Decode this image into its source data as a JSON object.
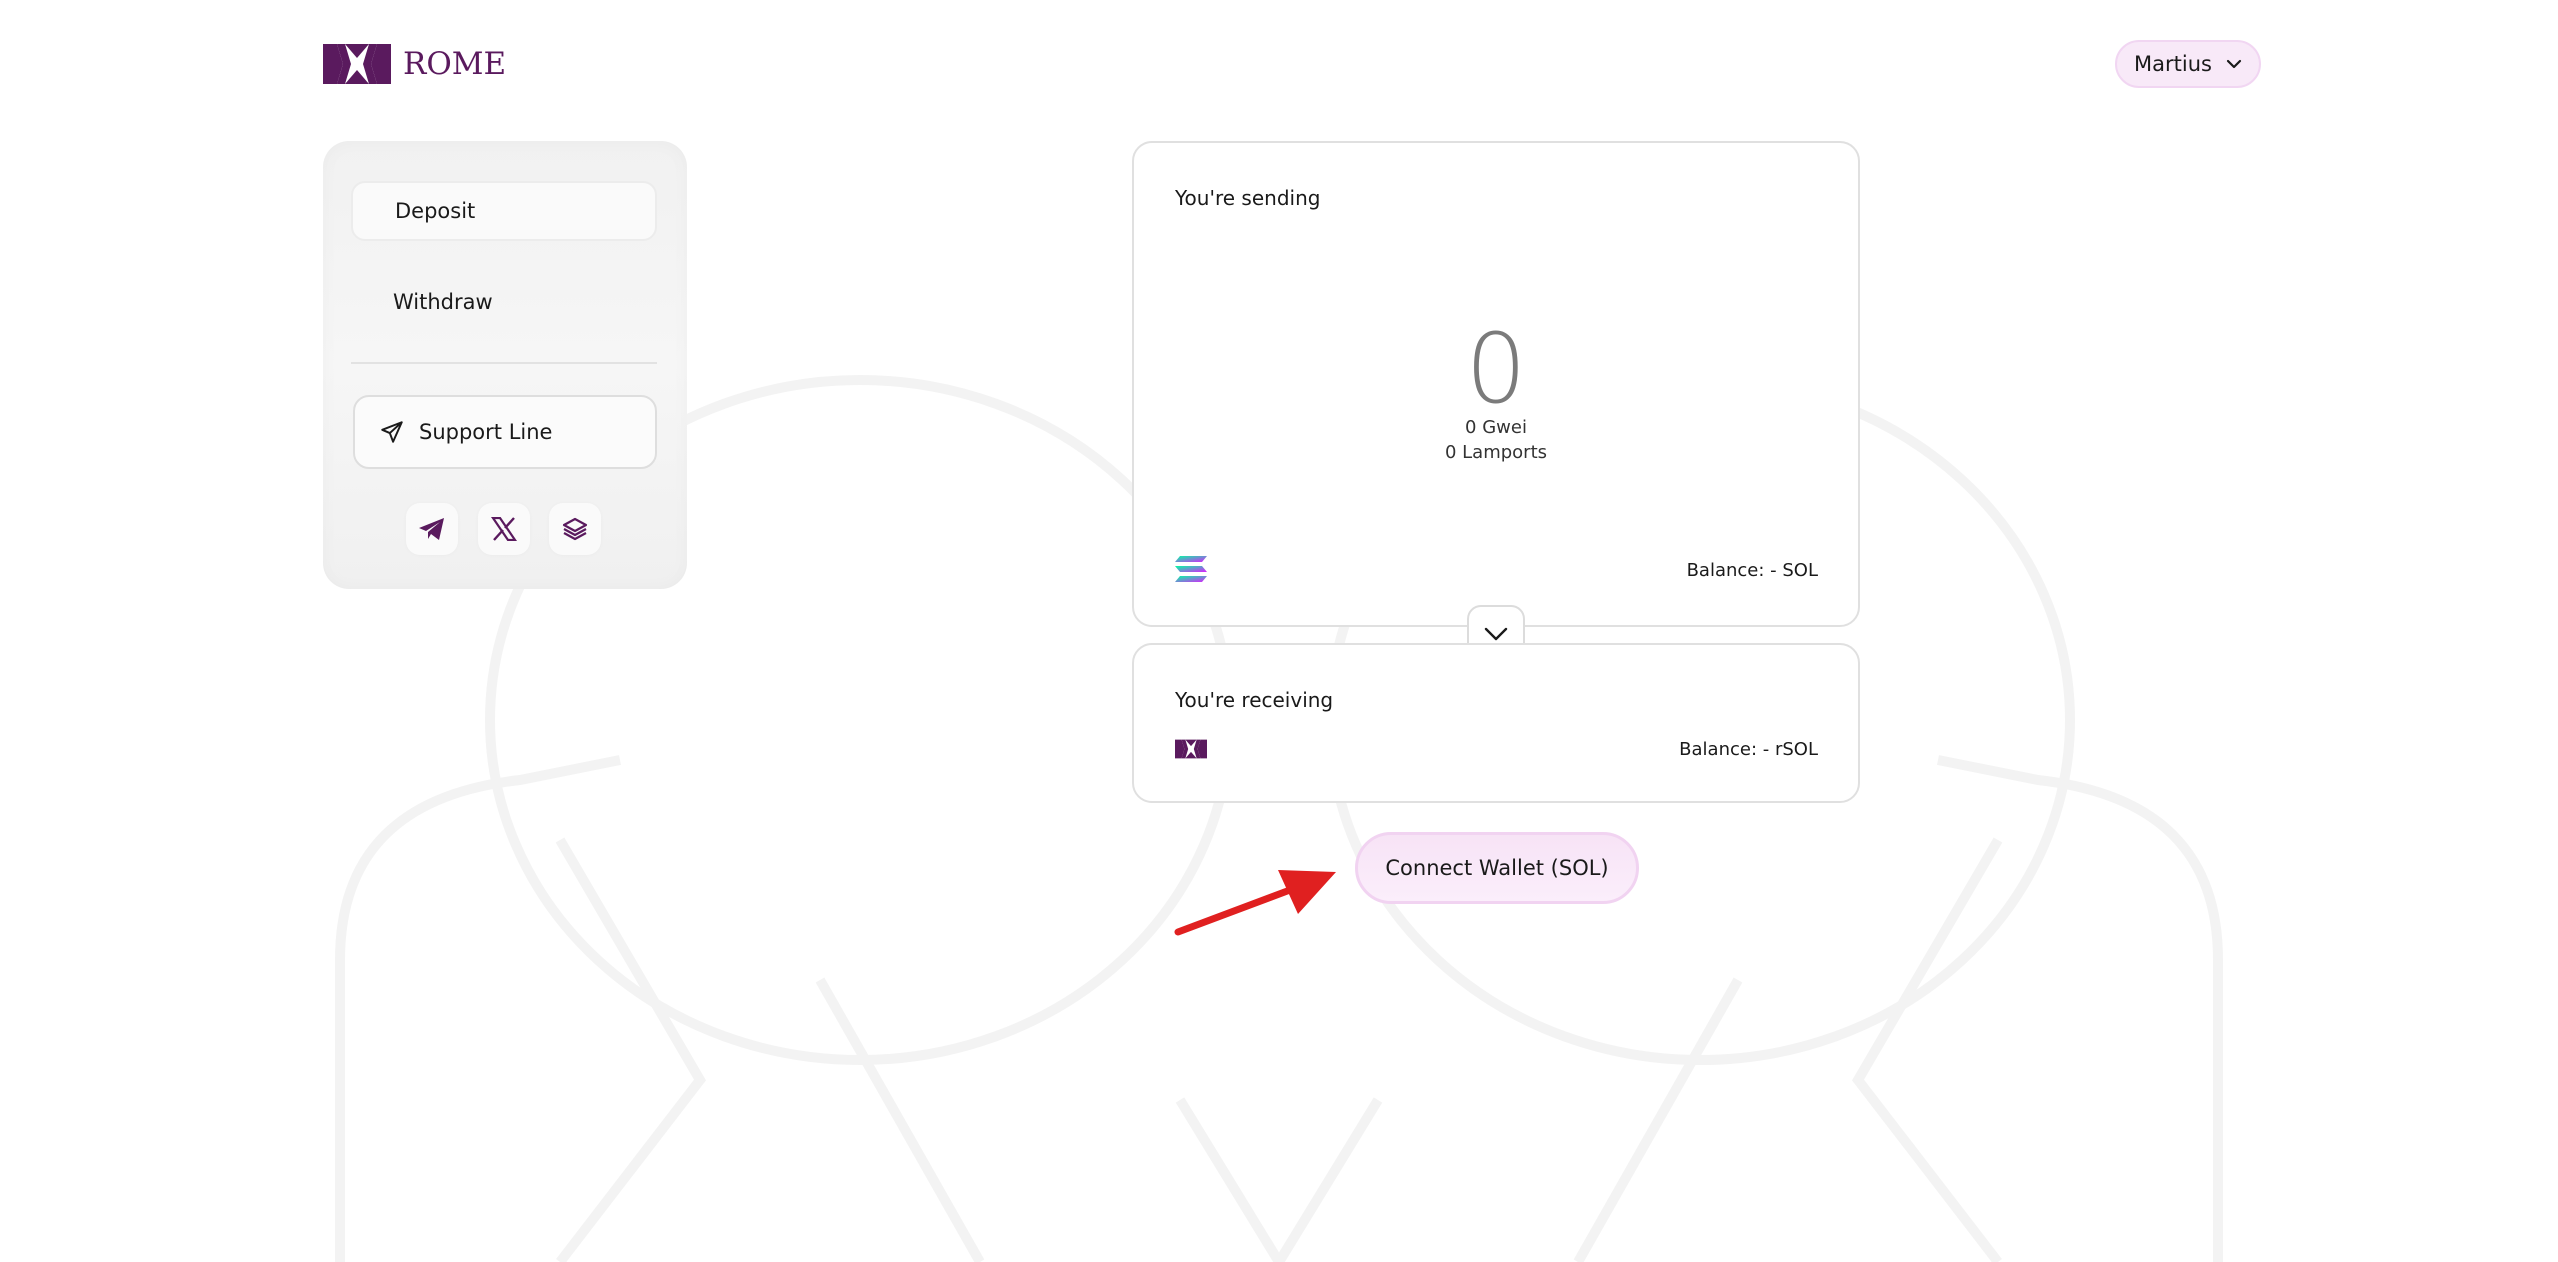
{
  "brand": {
    "name": "ROME",
    "color": "#5a1a5e"
  },
  "header": {
    "account_name": "Martius",
    "account_icon": "chevron-down-icon"
  },
  "sidebar": {
    "nav": [
      {
        "label": "Deposit",
        "active": true
      },
      {
        "label": "Withdraw",
        "active": false
      }
    ],
    "support_label": "Support Line",
    "support_icon": "paper-plane-icon",
    "socials": [
      "telegram-icon",
      "x-icon",
      "docs-stack-icon"
    ]
  },
  "send": {
    "label": "You're sending",
    "amount": "0",
    "gwei": "0 Gwei",
    "lamports": "0 Lamports",
    "token_icon": "solana-icon",
    "balance": "Balance: - SOL"
  },
  "receive": {
    "label": "You're receiving",
    "token_icon": "rome-token-icon",
    "balance": "Balance: - rSOL"
  },
  "connect_label": "Connect Wallet (SOL)",
  "accent_colors": {
    "pink_bg": "#f8e9f8",
    "arrow": "#e02020"
  }
}
